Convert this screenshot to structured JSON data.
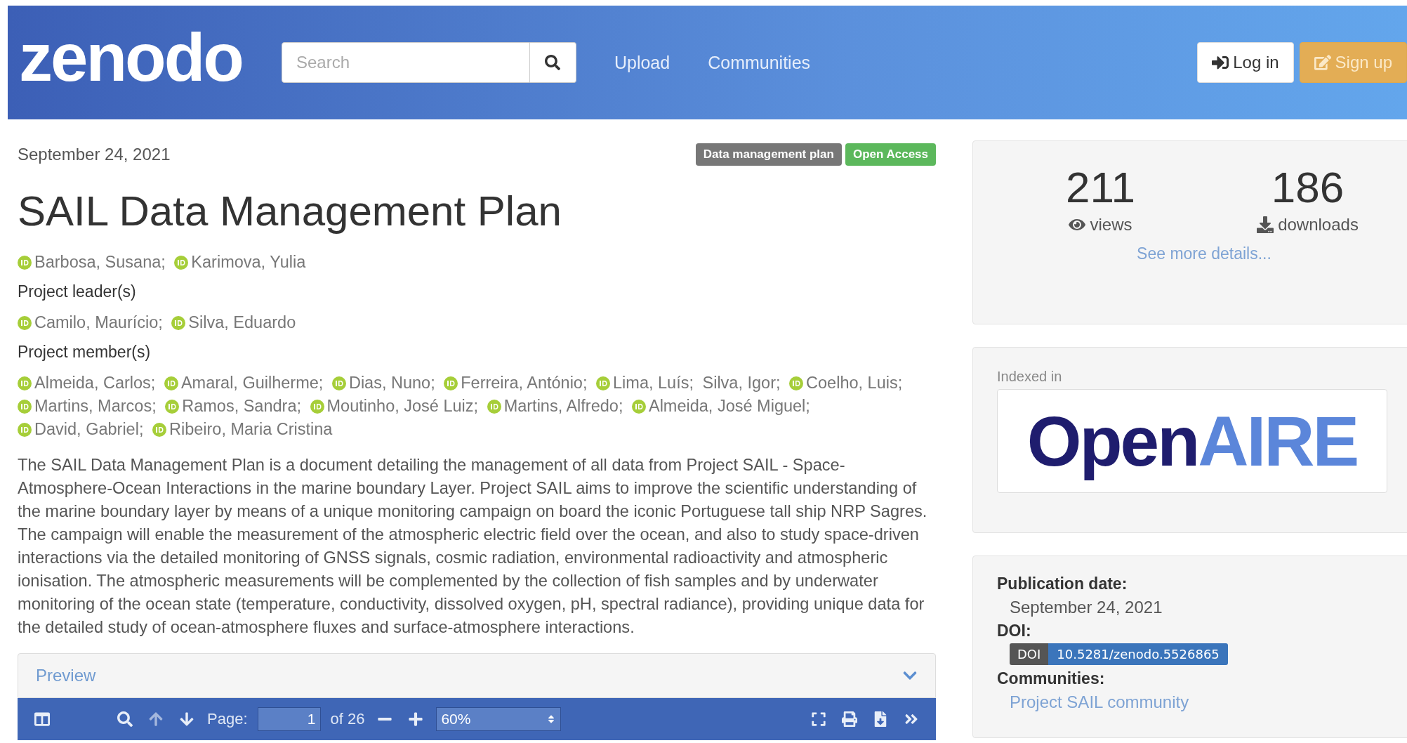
{
  "header": {
    "logo": "zenodo",
    "search": {
      "placeholder": "Search"
    },
    "nav": [
      "Upload",
      "Communities"
    ],
    "buttons": [
      {
        "kind": "login",
        "label": "Log in"
      },
      {
        "kind": "signup",
        "label": "Sign up"
      }
    ]
  },
  "record": {
    "date": "September 24, 2021",
    "badges": [
      {
        "label": "Data management plan",
        "color": "#777777"
      },
      {
        "label": "Open Access",
        "color": "#5cb85c"
      }
    ],
    "title": "SAIL Data Management Plan",
    "creators": [
      {
        "name": "Barbosa, Susana;",
        "orcid": true
      },
      {
        "name": "Karimova, Yulia",
        "orcid": true
      }
    ],
    "groups": [
      {
        "heading": "Project leader(s)",
        "people": [
          {
            "name": "Camilo, Maurício;",
            "orcid": true
          },
          {
            "name": "Silva, Eduardo",
            "orcid": true
          }
        ]
      },
      {
        "heading": "Project member(s)",
        "people": [
          {
            "name": "Almeida, Carlos;",
            "orcid": true
          },
          {
            "name": "Amaral, Guilherme;",
            "orcid": true
          },
          {
            "name": "Dias, Nuno;",
            "orcid": true
          },
          {
            "name": "Ferreira, António;",
            "orcid": true
          },
          {
            "name": "Lima, Luís;",
            "orcid": true
          },
          {
            "name": "Silva, Igor;",
            "orcid": false
          },
          {
            "name": "Coelho, Luis;",
            "orcid": true
          },
          {
            "name": "Martins, Marcos;",
            "orcid": true
          },
          {
            "name": "Ramos, Sandra;",
            "orcid": true
          },
          {
            "name": "Moutinho, José Luiz;",
            "orcid": true
          },
          {
            "name": "Martins, Alfredo;",
            "orcid": true
          },
          {
            "name": "Almeida, José Miguel;",
            "orcid": true
          },
          {
            "name": "David, Gabriel;",
            "orcid": true
          },
          {
            "name": "Ribeiro, Maria Cristina",
            "orcid": true
          }
        ]
      }
    ],
    "description": "The SAIL Data Management Plan is a document detailing the management of all data from Project SAIL - Space-Atmosphere-Ocean Interactions in the marine boundary Layer. Project SAIL aims to improve the scientific understanding of the marine boundary layer by means of a unique monitoring campaign on board the iconic Portuguese tall ship NRP Sagres. The campaign will enable the measurement of the atmospheric electric field over the ocean, and also to study space-driven interactions via the detailed monitoring of GNSS signals, cosmic radiation, environmental radioactivity and atmospheric ionisation. The atmospheric measurements will be complemented by the collection of fish samples and by underwater monitoring of the ocean state (temperature, conductivity, dissolved oxygen, pH, spectral radiance), providing unique data for the detailed study of ocean-atmosphere fluxes and surface-atmosphere interactions.",
    "preview": {
      "title": "Preview",
      "expanded": true,
      "toolbar": {
        "page_label": "Page:",
        "page": "1",
        "page_count": "of 26",
        "zoom": "60%"
      }
    }
  },
  "sidebar": {
    "stats": [
      {
        "kind": "views",
        "value": "211",
        "label": "views"
      },
      {
        "kind": "downloads",
        "value": "186",
        "label": "downloads"
      }
    ],
    "details_link": "See more details...",
    "indexed": {
      "label": "Indexed in",
      "logo": [
        "Open",
        "AIRE"
      ]
    },
    "info": {
      "publication_date": {
        "label": "Publication date:",
        "value": "September 24, 2021"
      },
      "doi": {
        "label": "DOI:",
        "tag": "DOI",
        "value": "10.5281/zenodo.5526865"
      },
      "communities": {
        "label": "Communities:",
        "value": "Project SAIL community"
      }
    }
  }
}
